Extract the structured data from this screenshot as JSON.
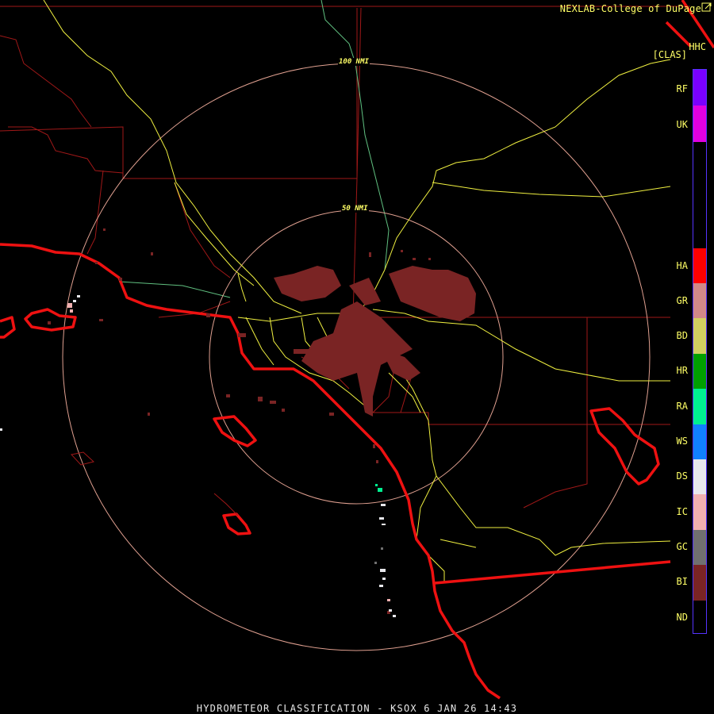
{
  "header": {
    "credit": "NEXLAB-College of DuPage",
    "product_code": "HHC",
    "product_name": "[CLAS]"
  },
  "range_rings": [
    {
      "label": "100 NMI"
    },
    {
      "label": "50 NMI"
    }
  ],
  "legend": {
    "items": [
      {
        "code": "RF",
        "color": "#7a00ff"
      },
      {
        "code": "UK",
        "color": "#e000e0"
      },
      {
        "code": "HA",
        "color": "#ff0000"
      },
      {
        "code": "GR",
        "color": "#d08888"
      },
      {
        "code": "BD",
        "color": "#d0d060"
      },
      {
        "code": "HR",
        "color": "#00a000"
      },
      {
        "code": "RA",
        "color": "#00f090"
      },
      {
        "code": "WS",
        "color": "#1080ff"
      },
      {
        "code": "DS",
        "color": "#e8e8ec"
      },
      {
        "code": "IC",
        "color": "#f0b0b0"
      },
      {
        "code": "GC",
        "color": "#707070"
      },
      {
        "code": "BI",
        "color": "#7a2424"
      },
      {
        "code": "ND",
        "color": "#000000"
      }
    ]
  },
  "colors": {
    "county_lines": "#a01818",
    "coast_state": "#ee1111",
    "highways": "#f0f040",
    "rings": "#e0a090",
    "river": "#60c080"
  },
  "footer": {
    "title": "HYDROMETEOR CLASSIFICATION - KSOX 6 JAN 26 14:43"
  }
}
